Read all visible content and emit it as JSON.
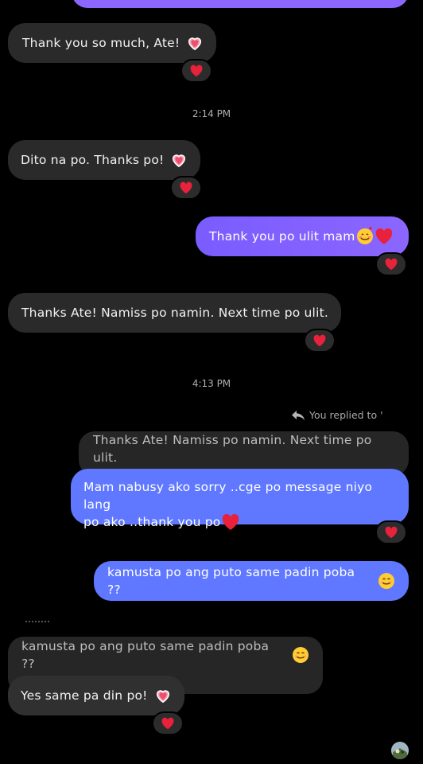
{
  "messages": {
    "m1": "Thank you so much, Ate!",
    "t1": "2:14 PM",
    "m2": "Dito na po. Thanks po!",
    "m3": "Thank you po ulit mam",
    "m4": "Thanks Ate! Namiss po namin. Next time po ulit.",
    "t2": "4:13 PM",
    "reply_header": "You replied to '",
    "quoted1": "Thanks Ate! Namiss po namin. Next time po ulit.",
    "m5_line1": "Mam nabusy ako sorry ..cge po message niyo lang",
    "m5_line2": "po ako ..thank you po",
    "m6": "kamusta po ang puto same padin poba ??",
    "quoted2": "kamusta po ang puto same padin poba ??",
    "m7": "Yes same pa din po!"
  },
  "icons": {
    "reaction": "heart-icon",
    "reply": "reply-arrow-icon",
    "smile": "smiling-face-icon",
    "love": "smiling-face-with-hearts-icon"
  },
  "colors": {
    "background": "#000000",
    "incoming": "#2a2a2a",
    "outgoing_purple": "#8b66ff",
    "outgoing_blue": "#5f78ff",
    "heart": "#e8223b"
  }
}
